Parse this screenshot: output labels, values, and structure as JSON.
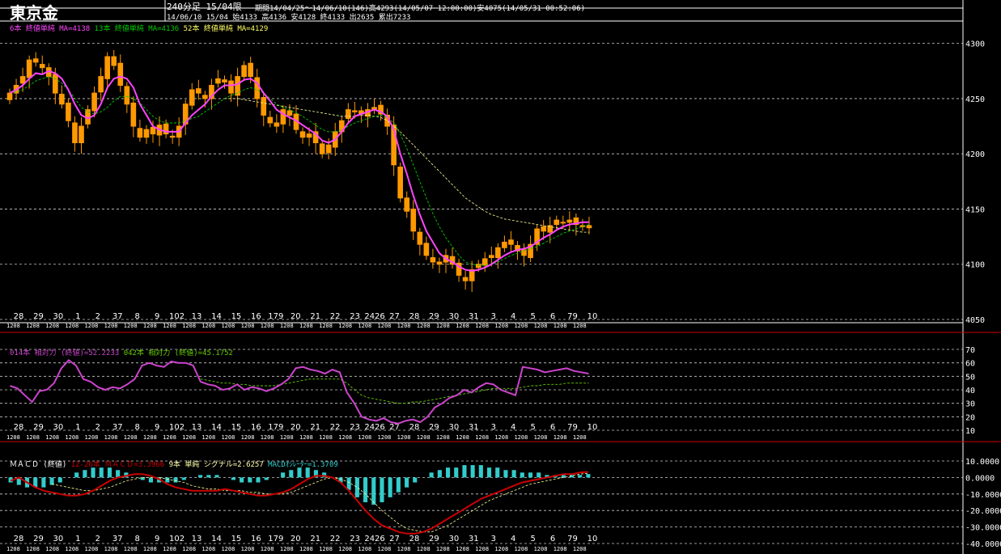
{
  "app": {
    "title": "東京金",
    "period": "240分足 15/04限",
    "info1": "期間14/04/25～14/06/10(146)高4293(14/05/07 12:00:00)安4075(14/05/31 00:52:06)",
    "info2": "14/06/10 15/04 始4133 高4136 安4128 終4133 出2635 累出7233"
  },
  "colors": {
    "background": "#000000",
    "grid": "#ffffff",
    "candle": "#ff9900",
    "ma_short": "#ff44ff",
    "ma_mid": "#00cc00",
    "ma_long": "#ffff99",
    "rsi_short": "#cc44cc",
    "rsi_long": "#66cc00",
    "macd": "#cc0000",
    "signal": "#ffff99",
    "osc": "#33cccc",
    "separator": "#cc0000"
  },
  "price_legend": {
    "ma6": "6本 終値単純 MA=4138",
    "ma13": "13本 終値単純 MA=4136",
    "ma52": "52本 終値単純 MA=4129"
  },
  "rsi_legend": {
    "rsi14": "014本 相対力 (終値)=52.2233",
    "rsi42": "042本 相対力 (終値)=45.1752"
  },
  "macd_legend": {
    "label": "ＭＡＣＤ (終値)",
    "macd": "12-26本 ＭＡＣＤ=3.3966",
    "signal": "9本 単純 シグナル=2.6257",
    "osc": "MACDｵｼﾚｰﾀｰ=1.3709"
  },
  "x_day_labels": [
    "28",
    "29",
    "30",
    "1",
    "2",
    "37",
    "8",
    "9",
    "102",
    "13",
    "14",
    "15",
    "16",
    "179",
    "20",
    "21",
    "22",
    "23",
    "2426",
    "27",
    "28",
    "29",
    "30",
    "31",
    "3",
    "4",
    "5",
    "6",
    "79",
    "10"
  ],
  "x_time_label": "1208",
  "chart_data": [
    {
      "type": "candlestick",
      "title": "東京金",
      "ylim": [
        4050,
        4310
      ],
      "yticks": [
        4050,
        4100,
        4150,
        4200,
        4250,
        4300
      ],
      "grid": true,
      "close": [
        4255,
        4262,
        4270,
        4285,
        4283,
        4278,
        4270,
        4255,
        4245,
        4230,
        4210,
        4225,
        4240,
        4255,
        4270,
        4288,
        4280,
        4262,
        4245,
        4225,
        4215,
        4222,
        4218,
        4226,
        4218,
        4215,
        4225,
        4245,
        4258,
        4255,
        4250,
        4262,
        4268,
        4265,
        4255,
        4270,
        4280,
        4270,
        4250,
        4235,
        4228,
        4225,
        4240,
        4235,
        4222,
        4215,
        4218,
        4210,
        4200,
        4208,
        4220,
        4230,
        4240,
        4238,
        4236,
        4240,
        4242,
        4236,
        4225,
        4190,
        4160,
        4148,
        4130,
        4118,
        4108,
        4102,
        4100,
        4108,
        4100,
        4090,
        4085,
        4095,
        4100,
        4105,
        4108,
        4115,
        4120,
        4118,
        4112,
        4108,
        4118,
        4132,
        4130,
        4135,
        4140,
        4138,
        4140,
        4136,
        4134,
        4133
      ],
      "ma6": [
        4255,
        4258,
        4262,
        4268,
        4273,
        4272,
        4275,
        4273,
        4268,
        4258,
        4245,
        4235,
        4232,
        4235,
        4245,
        4260,
        4268,
        4270,
        4268,
        4260,
        4245,
        4235,
        4225,
        4222,
        4220,
        4220,
        4220,
        4228,
        4235,
        4240,
        4245,
        4252,
        4258,
        4262,
        4262,
        4263,
        4267,
        4268,
        4264,
        4255,
        4248,
        4240,
        4236,
        4233,
        4230,
        4226,
        4222,
        4218,
        4212,
        4210,
        4213,
        4220,
        4228,
        4234,
        4236,
        4238,
        4240,
        4238,
        4234,
        4222,
        4200,
        4182,
        4162,
        4145,
        4130,
        4120,
        4110,
        4105,
        4102,
        4098,
        4095,
        4094,
        4095,
        4097,
        4100,
        4104,
        4108,
        4111,
        4113,
        4114,
        4116,
        4120,
        4124,
        4127,
        4131,
        4134,
        4136,
        4137,
        4138,
        4138
      ],
      "ma13": [
        4255,
        4256,
        4258,
        4262,
        4266,
        4268,
        4270,
        4268,
        4264,
        4258,
        4250,
        4242,
        4238,
        4236,
        4238,
        4242,
        4248,
        4252,
        4252,
        4250,
        4246,
        4240,
        4234,
        4230,
        4228,
        4228,
        4228,
        4230,
        4232,
        4234,
        4238,
        4242,
        4246,
        4250,
        4253,
        4255,
        4258,
        4260,
        4258,
        4255,
        4250,
        4245,
        4242,
        4240,
        4237,
        4234,
        4230,
        4226,
        4222,
        4220,
        4220,
        4222,
        4225,
        4228,
        4230,
        4232,
        4234,
        4235,
        4233,
        4228,
        4218,
        4205,
        4190,
        4175,
        4160,
        4146,
        4134,
        4124,
        4116,
        4108,
        4102,
        4100,
        4099,
        4099,
        4100,
        4102,
        4105,
        4108,
        4110,
        4112,
        4114,
        4116,
        4119,
        4122,
        4125,
        4128,
        4130,
        4132,
        4134,
        4136
      ],
      "ma52": [
        null,
        null,
        null,
        null,
        null,
        null,
        null,
        null,
        null,
        null,
        null,
        null,
        null,
        null,
        null,
        null,
        null,
        null,
        null,
        null,
        null,
        null,
        null,
        null,
        null,
        null,
        null,
        null,
        null,
        null,
        null,
        null,
        null,
        4250,
        4250,
        4250,
        4249,
        4248,
        4247,
        4246,
        4245,
        4244,
        4243,
        4242,
        4241,
        4240,
        4239,
        4238,
        4237,
        4236,
        4235,
        4234,
        4234,
        4234,
        4235,
        4235,
        4234,
        4233,
        4230,
        4225,
        4220,
        4214,
        4208,
        4202,
        4196,
        4190,
        4184,
        4178,
        4172,
        4166,
        4160,
        4156,
        4152,
        4148,
        4145,
        4143,
        4141,
        4140,
        4139,
        4138,
        4137,
        4136,
        4135,
        4134,
        4133,
        4132,
        4131,
        4130,
        4129,
        4129
      ]
    },
    {
      "type": "line",
      "title": "相対力",
      "ylim": [
        10,
        70
      ],
      "yticks": [
        10,
        20,
        30,
        40,
        50,
        60,
        70
      ],
      "series": [
        {
          "name": "014本 相対力 (終値)",
          "values": [
            43,
            41,
            36,
            31,
            39,
            40,
            45,
            56,
            62,
            58,
            48,
            46,
            42,
            40,
            42,
            41,
            44,
            48,
            58,
            60,
            58,
            57,
            61,
            60,
            60,
            58,
            46,
            44,
            43,
            40,
            41,
            44,
            40,
            42,
            41,
            39,
            41,
            44,
            48,
            56,
            57,
            55,
            54,
            52,
            55,
            53,
            38,
            30,
            20,
            18,
            17,
            19,
            16,
            15,
            17,
            18,
            16,
            20,
            27,
            30,
            34,
            36,
            40,
            38,
            42,
            45,
            44,
            40,
            38,
            36,
            57,
            56,
            55,
            53,
            54,
            55,
            56,
            54,
            53,
            52
          ]
        },
        {
          "name": "042本 相対力 (終値)",
          "values": [
            null,
            null,
            null,
            null,
            null,
            null,
            null,
            null,
            null,
            null,
            null,
            null,
            null,
            null,
            null,
            null,
            null,
            null,
            null,
            null,
            null,
            null,
            null,
            null,
            null,
            null,
            48,
            47,
            46,
            45,
            45,
            44,
            44,
            43,
            43,
            43,
            43,
            44,
            45,
            46,
            47,
            48,
            48,
            48,
            48,
            48,
            45,
            40,
            36,
            34,
            33,
            32,
            31,
            30,
            30,
            31,
            31,
            32,
            33,
            34,
            35,
            36,
            37,
            38,
            39,
            40,
            41,
            41,
            41,
            41,
            42,
            43,
            43,
            44,
            44,
            44,
            45,
            45,
            45,
            45
          ]
        }
      ]
    },
    {
      "type": "line",
      "title": "ＭＡＣＤ (終値)",
      "ylim": [
        -40,
        10
      ],
      "yticks": [
        10,
        0,
        -10,
        -20,
        -30,
        -40
      ],
      "ytick_labels": [
        "10.0000",
        "0.0000",
        "-10.0000",
        "-20.0000",
        "-30.0000",
        "-40.0000"
      ],
      "series": [
        {
          "name": "12-26本 ＭＡＣＤ",
          "values": [
            -2,
            0,
            -3,
            -6,
            -8,
            -9,
            -10,
            -11,
            -11,
            -10,
            -8,
            -5,
            -2,
            0,
            1,
            2,
            2,
            1,
            -1,
            -4,
            -6,
            -7,
            -8,
            -8,
            -8,
            -8,
            -7,
            -8,
            -9,
            -10,
            -11,
            -11,
            -10,
            -9,
            -7,
            -4,
            -1,
            1,
            1,
            0,
            -3,
            -8,
            -14,
            -20,
            -25,
            -29,
            -31,
            -33,
            -34,
            -34,
            -33,
            -31,
            -28,
            -25,
            -22,
            -19,
            -16,
            -13,
            -11,
            -9,
            -7,
            -5,
            -3,
            -2,
            -1,
            0,
            1,
            2,
            2,
            3,
            3.4
          ]
        },
        {
          "name": "9本 単純 シグナル",
          "values": [
            null,
            null,
            null,
            null,
            null,
            -4,
            -5,
            -6,
            -7,
            -8,
            -8,
            -7,
            -6,
            -4,
            -2,
            -1,
            0,
            0,
            0,
            -1,
            -2,
            -3,
            -5,
            -6,
            -7,
            -7,
            -8,
            -8,
            -8,
            -9,
            -9,
            -10,
            -10,
            -10,
            -9,
            -7,
            -5,
            -3,
            -1,
            0,
            -1,
            -3,
            -6,
            -10,
            -15,
            -20,
            -24,
            -28,
            -31,
            -32,
            -33,
            -33,
            -31,
            -29,
            -26,
            -23,
            -20,
            -17,
            -14,
            -12,
            -10,
            -8,
            -6,
            -4,
            -3,
            -2,
            -1,
            0,
            1,
            2,
            2.6
          ]
        },
        {
          "name": "MACDｵｼﾚｰﾀｰ",
          "values": [
            -2,
            -3,
            -4,
            -4,
            -4,
            -3,
            -2,
            0,
            2,
            3,
            4,
            4,
            4,
            3,
            2,
            0,
            -1,
            -2,
            -2,
            -2,
            -2,
            -1,
            0,
            1,
            1,
            1,
            0,
            -1,
            -2,
            -2,
            -2,
            -1,
            0,
            2,
            3,
            4,
            4,
            3,
            2,
            0,
            -2,
            -5,
            -8,
            -10,
            -11,
            -10,
            -8,
            -6,
            -4,
            -2,
            0,
            2,
            3,
            4,
            4,
            5,
            5,
            5,
            4,
            4,
            3,
            3,
            2,
            2,
            2,
            1,
            1,
            1,
            1,
            1,
            1.4
          ]
        }
      ]
    }
  ]
}
